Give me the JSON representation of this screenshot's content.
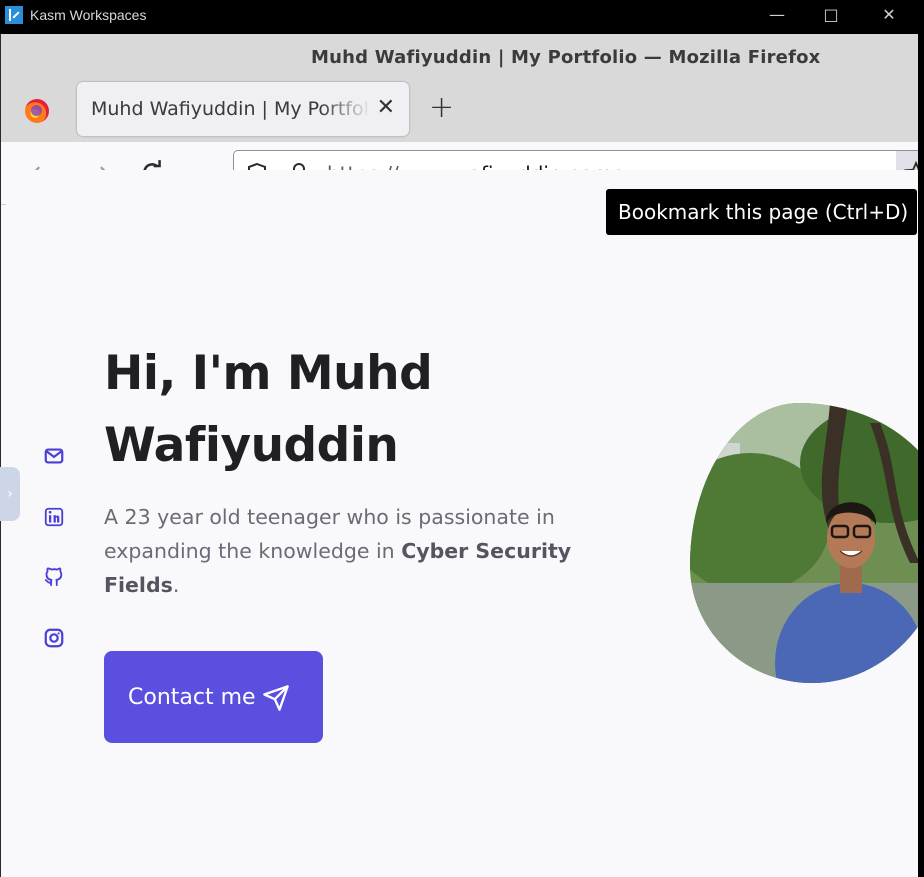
{
  "kasm": {
    "title": "Kasm Workspaces"
  },
  "firefox": {
    "window_title": "Muhd Wafiyuddin | My Portfolio — Mozilla Firefox",
    "tab": {
      "label": "Muhd Wafiyuddin | My Portfolio"
    },
    "url": {
      "prefix": "https://www.",
      "host": "wafiyuddin.name"
    },
    "tooltip": "Bookmark this page (Ctrl+D)"
  },
  "page": {
    "hero": {
      "title_line1": "Hi, I'm Muhd",
      "title_line2": "Wafiyuddin",
      "desc_part1": "A 23 year old teenager who is passionate in expanding the knowledge in ",
      "desc_bold": "Cyber Security Fields",
      "desc_part2": ".",
      "contact_label": "Contact me"
    },
    "social_icons": [
      "mail-icon",
      "linkedin-icon",
      "github-icon",
      "instagram-icon"
    ]
  },
  "colors": {
    "accent": "#5b4fe0",
    "social": "#4b3fd6"
  }
}
